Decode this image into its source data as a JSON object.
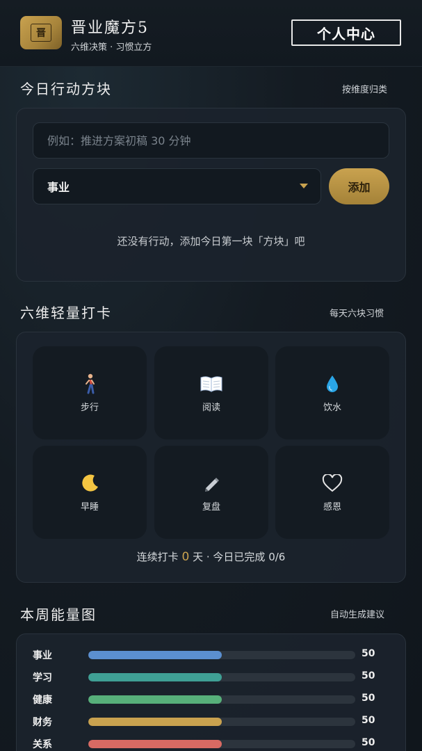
{
  "header": {
    "logo_char": "晋",
    "title": "晋业魔方5",
    "subtitle": "六维决策 · 习惯立方",
    "profile_button": "个人中心"
  },
  "actions": {
    "title": "今日行动方块",
    "link": "按维度归类",
    "input_placeholder": "例如：推进方案初稿 30 分钟",
    "input_value": "",
    "select_value": "事业",
    "add_button": "添加",
    "empty_text": "还没有行动，添加今日第一块「方块」吧"
  },
  "checkin": {
    "title": "六维轻量打卡",
    "link": "每天六块习惯",
    "items": [
      {
        "label": "步行",
        "icon": "walking-person-icon"
      },
      {
        "label": "阅读",
        "icon": "open-book-icon"
      },
      {
        "label": "饮水",
        "icon": "water-drop-icon"
      },
      {
        "label": "早睡",
        "icon": "crescent-moon-icon"
      },
      {
        "label": "复盘",
        "icon": "pencil-icon"
      },
      {
        "label": "感恩",
        "icon": "heart-icon"
      }
    ],
    "streak_prefix": "连续打卡",
    "streak_days": "0",
    "streak_unit": "天",
    "separator": "·",
    "today_done": "今日已完成 0/6"
  },
  "energy": {
    "title": "本周能量图",
    "link": "自动生成建议",
    "bars": [
      {
        "label": "事业",
        "value": 50,
        "display": "50",
        "color": "#5b8fd0"
      },
      {
        "label": "学习",
        "value": 50,
        "display": "50",
        "color": "#3fa095"
      },
      {
        "label": "健康",
        "value": 50,
        "display": "50",
        "color": "#57b07a"
      },
      {
        "label": "财务",
        "value": 50,
        "display": "50",
        "color": "#c9a24f"
      },
      {
        "label": "关系",
        "value": 50,
        "display": "50",
        "color": "#d86a63"
      }
    ],
    "max": 100
  }
}
